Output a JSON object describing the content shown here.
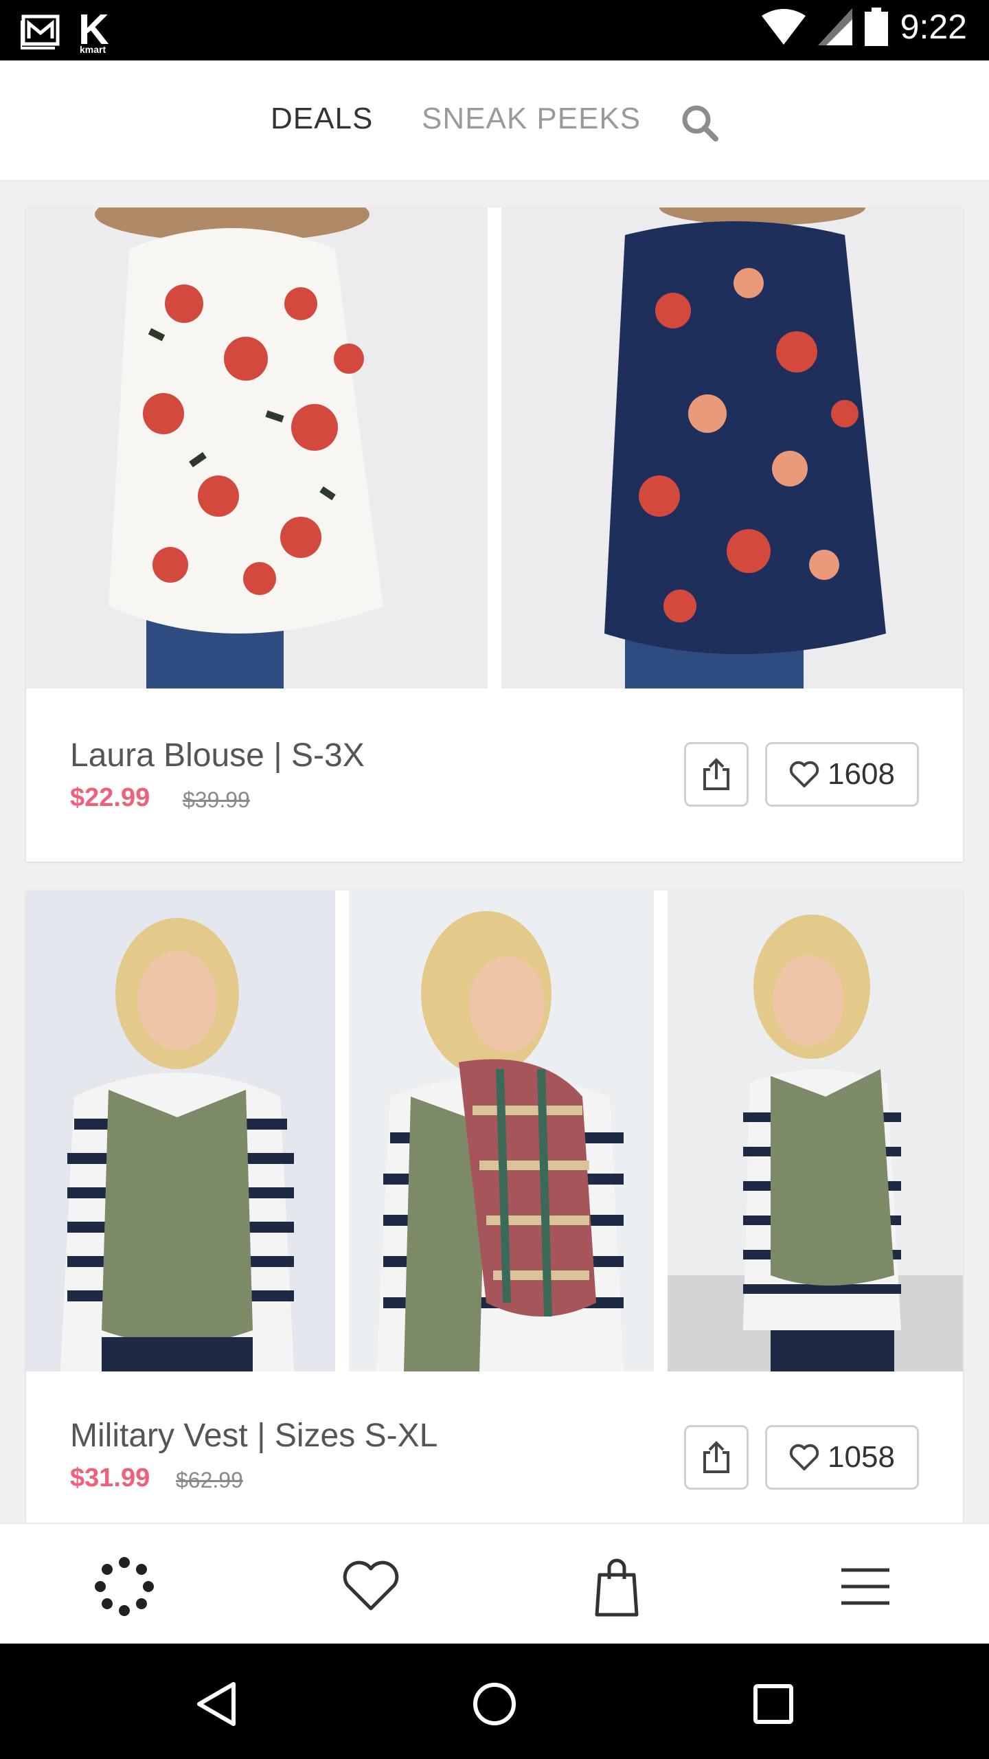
{
  "status_bar": {
    "time": "9:22"
  },
  "top_nav": {
    "tabs": [
      {
        "label": "DEALS",
        "active": true
      },
      {
        "label": "SNEAK PEEKS",
        "active": false
      }
    ],
    "search_icon": "search-icon"
  },
  "products": [
    {
      "title": "Laura Blouse | S-3X",
      "price": "$22.99",
      "old_price": "$39.99",
      "likes": "1608",
      "images": [
        "white floral blouse front",
        "navy floral blouse back"
      ]
    },
    {
      "title": "Military Vest | Sizes S-XL",
      "price": "$31.99",
      "old_price": "$62.99",
      "likes": "1058",
      "images": [
        "olive vest with striped top",
        "olive vest with plaid scarf",
        "olive vest side view"
      ]
    }
  ],
  "bottom_bar": {
    "items": [
      "deals-icon",
      "favorites-heart-icon",
      "shopping-bag-icon",
      "menu-icon"
    ]
  },
  "colors": {
    "price": "#f0607a",
    "accent_text": "#333333",
    "inactive_tab": "#9a9a9a"
  }
}
